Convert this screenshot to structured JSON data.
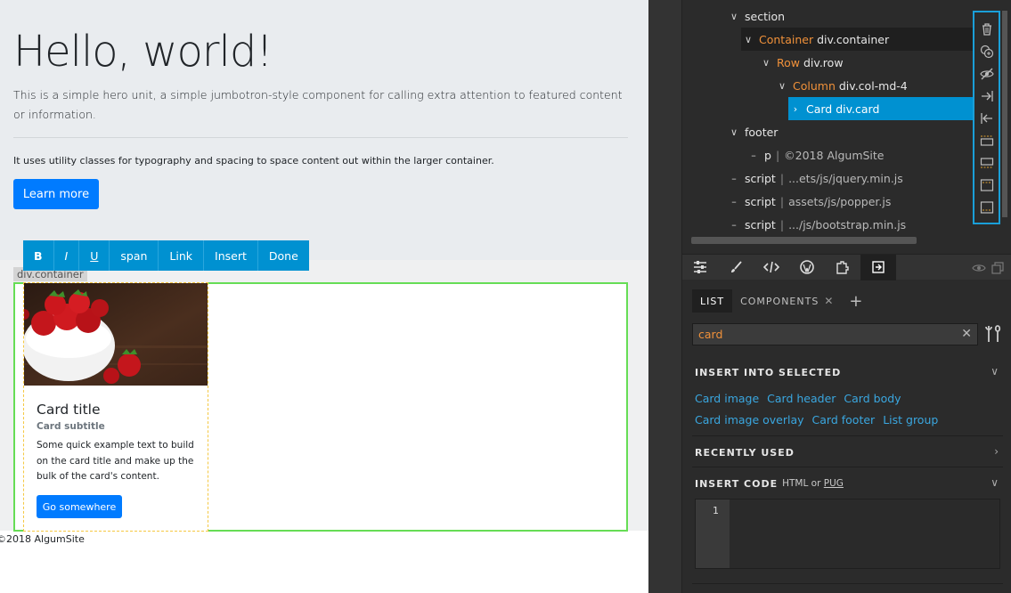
{
  "hero": {
    "title": "Hello, world!",
    "lead": "This is a simple hero unit, a simple jumbotron-style component for calling extra attention to featured content or information.",
    "text": "It uses utility classes for typography and spacing to space content out within the larger container.",
    "button": "Learn more"
  },
  "editor_toolbar": {
    "items": [
      "B",
      "I",
      "U",
      "span",
      "Link",
      "Insert",
      "Done"
    ]
  },
  "container_tag": "div.container",
  "card": {
    "title": "Card title",
    "subtitle": "Card subtitle",
    "text": "Some quick example text to build on the card title and make up the bulk of the card's content.",
    "button": "Go somewhere"
  },
  "footer_text": "©2018 AlgumSite",
  "tree": {
    "rows": [
      {
        "kind": "section",
        "label": "section"
      },
      {
        "comp": "Container",
        "label": "div.container"
      },
      {
        "comp": "Row",
        "label": "div.row"
      },
      {
        "comp": "Column",
        "label": "div.col-md-4"
      },
      {
        "label": "Card div.card"
      },
      {
        "label": "footer"
      },
      {
        "tag": "p",
        "value": "©2018 AlgumSite"
      },
      {
        "tag": "script",
        "value": "...ets/js/jquery.min.js"
      },
      {
        "tag": "script",
        "value": "assets/js/popper.js"
      },
      {
        "tag": "script",
        "value": ".../js/bootstrap.min.js"
      }
    ]
  },
  "side_tools": [
    "trash-icon",
    "duplicate-icon",
    "hide-icon",
    "indent-icon",
    "outdent-icon",
    "insert-above-icon",
    "insert-below-icon",
    "wrap-top-icon",
    "wrap-bottom-icon"
  ],
  "panel_tabs": [
    "settings-icon",
    "brush-icon",
    "code-icon",
    "wordpress-icon",
    "plugins-icon",
    "insert-icon"
  ],
  "components": {
    "tabs": [
      "LIST",
      "COMPONENTS"
    ],
    "search_value": "card",
    "insert_into_selected": "INSERT INTO SELECTED",
    "links": [
      "Card image",
      "Card header",
      "Card body",
      "Card image overlay",
      "Card footer",
      "List group"
    ],
    "recently_used": "RECENTLY USED",
    "insert_code": "INSERT CODE",
    "insert_code_html": "HTML or",
    "insert_code_pug": "PUG",
    "line_number": "1"
  },
  "colors": {
    "accent": "#0091d1",
    "component_orange": "#f0913a",
    "link_blue": "#3aa7e0",
    "bootstrap_primary": "#007bff",
    "selection_green": "#66dd55"
  }
}
